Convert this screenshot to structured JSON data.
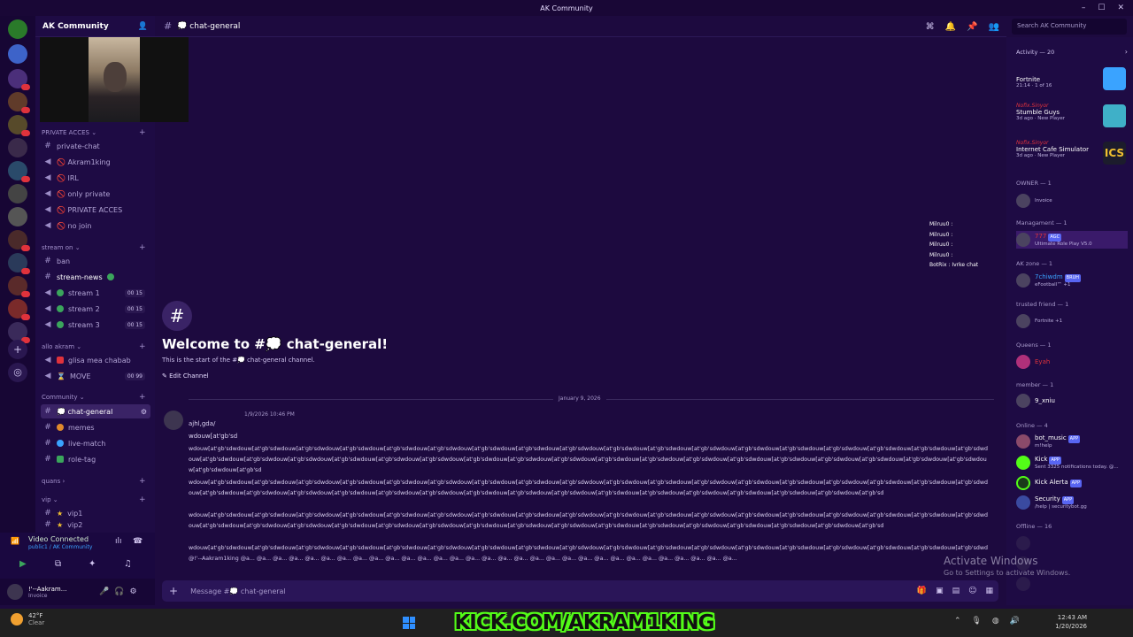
{
  "window": {
    "title": "AK Community"
  },
  "server": {
    "name": "AK Community"
  },
  "channel_header": {
    "name": "💭 chat-general"
  },
  "search": {
    "placeholder": "Search AK Community"
  },
  "categories": [
    {
      "label": "PRIVATE ACCES",
      "channels": [
        {
          "name": "private-chat"
        },
        {
          "name": "🚫 Akram1king"
        },
        {
          "name": "🚫 IRL"
        },
        {
          "name": "🚫 only private"
        },
        {
          "name": "🚫 PRIVATE ACCES"
        },
        {
          "name": "🚫 no join"
        }
      ]
    },
    {
      "label": "stream on",
      "channels": [
        {
          "name": "ban"
        },
        {
          "name": "stream-news"
        },
        {
          "name": "stream 1",
          "count": "00 15"
        },
        {
          "name": "stream 2",
          "count": "00 15"
        },
        {
          "name": "stream 3",
          "count": "00 15"
        }
      ]
    },
    {
      "label": "allo akram",
      "channels": [
        {
          "name": "glisa mea chabab"
        },
        {
          "name": "MOVE",
          "count": "00 99"
        }
      ]
    },
    {
      "label": "Community",
      "channels": [
        {
          "name": "💭 chat-general"
        },
        {
          "name": "memes"
        },
        {
          "name": "live-match"
        },
        {
          "name": "role-tag"
        }
      ]
    },
    {
      "label": "quans",
      "channels": []
    },
    {
      "label": "vip",
      "channels": [
        {
          "name": "vip1"
        },
        {
          "name": "vip2"
        }
      ]
    }
  ],
  "voice": {
    "status": "Video Connected",
    "location": "public1 / AK Community"
  },
  "user": {
    "name": "!'--Aakram...",
    "status": "Invoice"
  },
  "welcome": {
    "hash": "#",
    "title": "Welcome to #💭 chat-general!",
    "subtitle": "This is the start of the #💭 chat-general channel.",
    "edit": "Edit Channel"
  },
  "date_divider": "January 9, 2026",
  "message": {
    "timestamp": "1/9/2026 10:46 PM",
    "lines": [
      "ajhl,gda/",
      "wdouw[at'gb'sd",
      "wdouw[at'gb'sdwdouw[at'gb'sdwdouw[at'gb'sdwdouw[at'gb'sdwdouw[at'gb'sdwdouw[at'gb'sdwdouw[at'gb'sdwdouw[at'gb'sdwdouw[at'gb'sdwdouw[at'gb'sdwdouw[at'gb'sdwdouw[at'gb'sdwdouw[at'gb'sdwdouw[at'gb'sdwdouw[at'gb'sdwdouw[at'gb'sdwdouw[at'gb'sdwdouw[at'gb'sdwdouw[at'gb'sdwdouw[at'gb'sdwdouw[at'gb'sdwdouw[at'gb'sdwdouw[at'gb'sdwdouw[at'gb'sdwdouw[at'gb'sdwdouw[at'gb'sdwdouw[at'gb'sdwdouw[at'gb'sdwdouw[at'gb'sdwdouw[at'gb'sdwdouw[at'gb'sdwdouw[at'gb'sdwdouw[at'gb'sdwdouw[at'gb'sdwdouw[at'gb'sdwdouw[at'gb'sdwdouw[at'gb'sdwdouw[at'gb'sd",
      "wdouw[at'gb'sdwdouw[at'gb'sdwdouw[at'gb'sdwdouw[at'gb'sdwdouw[at'gb'sdwdouw[at'gb'sdwdouw[at'gb'sdwdouw[at'gb'sdwdouw[at'gb'sdwdouw[at'gb'sdwdouw[at'gb'sdwdouw[at'gb'sdwdouw[at'gb'sdwdouw[at'gb'sdwdouw[at'gb'sdwdouw[at'gb'sdwdouw[at'gb'sdwdouw[at'gb'sdwdouw[at'gb'sdwdouw[at'gb'sdwdouw[at'gb'sdwdouw[at'gb'sdwdouw[at'gb'sdwdouw[at'gb'sdwdouw[at'gb'sdwdouw[at'gb'sdwdouw[at'gb'sdwdouw[at'gb'sdwdouw[at'gb'sdwdouw[at'gb'sdwdouw[at'gb'sdwdouw[at'gb'sdwdouw[at'gb'sdwdouw[at'gb'sd",
      "wdouw[at'gb'sdwdouw[at'gb'sdwdouw[at'gb'sdwdouw[at'gb'sdwdouw[at'gb'sdwdouw[at'gb'sdwdouw[at'gb'sdwdouw[at'gb'sdwdouw[at'gb'sdwdouw[at'gb'sdwdouw[at'gb'sdwdouw[at'gb'sdwdouw[at'gb'sdwdouw[at'gb'sdwdouw[at'gb'sdwdouw[at'gb'sdwdouw[at'gb'sdwdouw[at'gb'sdwdouw[at'gb'sdwdouw[at'gb'sdwdouw[at'gb'sdwdouw[at'gb'sdwdouw[at'gb'sdwdouw[at'gb'sdwdouw[at'gb'sdwdouw[at'gb'sdwdouw[at'gb'sdwdouw[at'gb'sdwdouw[at'gb'sdwdouw[at'gb'sdwdouw[at'gb'sdwdouw[at'gb'sdwdouw[at'gb'sdwdouw[at'gb'sd",
      "wdouw[at'gb'sdwdouw[at'gb'sdwdouw[at'gb'sdwdouw[at'gb'sdwdouw[at'gb'sdwdouw[at'gb'sdwdouw[at'gb'sdwdouw[at'gb'sdwdouw[at'gb'sdwdouw[at'gb'sdwdouw[at'gb'sdwdouw[at'gb'sdwdouw[at'gb'sdwdouw[at'gb'sdwdouw[at'gb'sdwdouw[at'gb'sdwdouw[at'gb'sdwdouw[at'gb'sdwdouw[at'gb'sd",
      "@!'--Aakram1king @a... @a... @a... @a... @a... @a... @a... @a... @a... @a... @a... @a... @a... @a... @a... @a... @a... @a... @a... @a... @a... @a... @a... @a... @a... @a... @a... @a... @a... @a... @a..."
    ]
  },
  "overlay": {
    "lines": [
      "Milruu0 :",
      "Milruu0 :",
      "Milruu0 :",
      "Milruu0 :",
      "BotRix : Ivrke chat"
    ]
  },
  "composer": {
    "placeholder": "Message #💭 chat-general"
  },
  "members": {
    "activity_label": "Activity — 20",
    "activities": [
      {
        "game": "Fortnite",
        "sub": "21:14 · 1 of 16",
        "thumb_color": "#3aa3ff"
      },
      {
        "user": "Nofix.Sinyor",
        "game": "Stumble Guys",
        "sub": "3d ago · New Player",
        "thumb_color": "#3fb0c8"
      },
      {
        "user": "Nofix.Sinyor",
        "game": "Internet Cafe Simulator",
        "sub": "3d ago · New Player",
        "thumb_color": "#1c1c2c"
      }
    ],
    "groups": [
      {
        "label": "OWNER — 1",
        "items": [
          {
            "name": "",
            "status": "Invoice",
            "color": "#ffffff"
          }
        ]
      },
      {
        "label": "Managament — 1",
        "items": [
          {
            "name": "777",
            "status": "Ultimate Role Play V5.0",
            "color": "#e0323c",
            "tag": "AGC"
          }
        ]
      },
      {
        "label": "AK zone — 1",
        "items": [
          {
            "name": "7chiwdm",
            "status": "eFootball™ +1",
            "color": "#3aa3ff",
            "tag": "BRUH"
          }
        ]
      },
      {
        "label": "trusted friend — 1",
        "items": [
          {
            "name": "",
            "status": "Fortnite +1",
            "color": "#e0323c"
          }
        ]
      },
      {
        "label": "Queens — 1",
        "items": [
          {
            "name": "Eyah",
            "status": "",
            "color": "#e0323c"
          }
        ]
      },
      {
        "label": "member — 1",
        "items": [
          {
            "name": "9_xniu",
            "status": "",
            "color": "#ffffff"
          }
        ]
      },
      {
        "label": "Online — 4",
        "items": [
          {
            "name": "bot_music",
            "status": "m!help",
            "color": "#ffffff",
            "tag": "APP"
          },
          {
            "name": "Kick",
            "status": "Sent 3325 notifications today. @...",
            "color": "#ffffff",
            "tag": "APP"
          },
          {
            "name": "Kick Alerta",
            "status": "",
            "color": "#ffffff",
            "tag": "APP"
          },
          {
            "name": "Security",
            "status": "/help | securitybot.gg",
            "color": "#ffffff",
            "tag": "APP"
          }
        ]
      },
      {
        "label": "Offline — 16",
        "items": []
      }
    ]
  },
  "watermark": {
    "line1": "Activate Windows",
    "line2": "Go to Settings to activate Windows."
  },
  "taskbar": {
    "weather_temp": "42°F",
    "weather_text": "Clear",
    "kick_text": "KICK.COM/AKRAM1KING",
    "time": "12:43 AM",
    "date": "1/20/2026"
  }
}
